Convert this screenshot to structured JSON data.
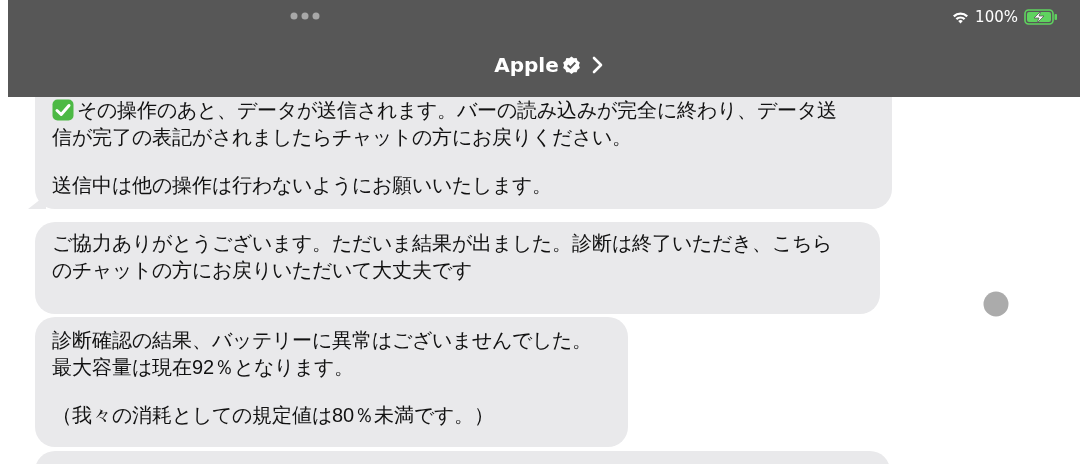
{
  "status_bar": {
    "battery_text": "100%"
  },
  "header": {
    "title": "Apple"
  },
  "messages": [
    {
      "kind": "check",
      "tail": true,
      "paragraphs": [
        [
          "その操作のあと、データが送信されます。バーの読み込みが完全に終わり、データ送",
          "信が完了の表記がされましたらチャットの方にお戻りください。"
        ],
        [
          "送信中は他の操作は行わないようにお願いいたします。"
        ]
      ]
    },
    {
      "kind": "plain",
      "tail": false,
      "paragraphs": [
        [
          "ご協力ありがとうございます。ただいま結果が出ました。診断は終了いただき、こちら",
          "のチャットの方にお戻りいただいて大丈夫です"
        ]
      ]
    },
    {
      "kind": "plain",
      "tail": false,
      "paragraphs": [
        [
          "診断確認の結果、バッテリーに異常はございませんでした。",
          "最大容量は現在92％となります。"
        ],
        [
          "（我々の消耗としての規定値は80％未満です。）"
        ]
      ]
    },
    {
      "kind": "cut"
    }
  ]
}
